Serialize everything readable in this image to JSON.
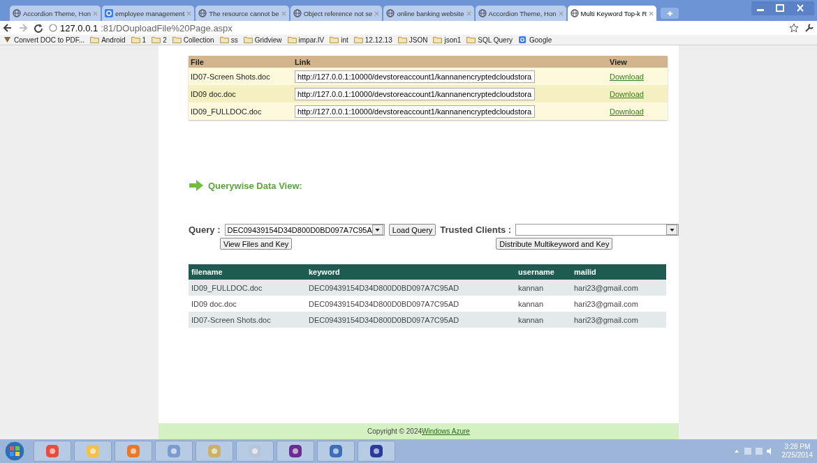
{
  "browser": {
    "tabs": [
      {
        "title": "Accordion Theme, Hon",
        "kind": "page",
        "selected": false
      },
      {
        "title": "employee management",
        "kind": "google",
        "selected": false
      },
      {
        "title": "The resource cannot be",
        "kind": "page",
        "selected": false
      },
      {
        "title": "Object reference not se",
        "kind": "page",
        "selected": false
      },
      {
        "title": "online banking website",
        "kind": "page",
        "selected": false
      },
      {
        "title": "Accordion Theme, Hon",
        "kind": "page",
        "selected": false
      },
      {
        "title": "Multi Keyword Top-k R",
        "kind": "page",
        "selected": true
      }
    ],
    "address": {
      "host": "127.0.0.1",
      "rest": ":81/DOuploadFile%20Page.aspx"
    },
    "bookmarks": [
      {
        "label": "Convert DOC to PDF...",
        "kind": "page"
      },
      {
        "label": "Android",
        "kind": "folder"
      },
      {
        "label": "1",
        "kind": "folder"
      },
      {
        "label": "2",
        "kind": "folder"
      },
      {
        "label": "Collection",
        "kind": "folder"
      },
      {
        "label": "ss",
        "kind": "folder"
      },
      {
        "label": "Gridview",
        "kind": "folder"
      },
      {
        "label": "impar.IV",
        "kind": "folder"
      },
      {
        "label": "int",
        "kind": "folder"
      },
      {
        "label": "12.12.13",
        "kind": "folder"
      },
      {
        "label": "JSON",
        "kind": "folder"
      },
      {
        "label": "json1",
        "kind": "folder"
      },
      {
        "label": "SQL Query",
        "kind": "folder"
      },
      {
        "label": "Google",
        "kind": "google"
      }
    ]
  },
  "files_table": {
    "columns": [
      "File",
      "Link",
      "View"
    ],
    "rows": [
      {
        "file": "ID07-Screen Shots.doc",
        "link": "http://127.0.0.1:10000/devstoreaccount1/kannanencryptedcloudstora",
        "action": "Download"
      },
      {
        "file": "ID09 doc.doc",
        "link": "http://127.0.0.1:10000/devstoreaccount1/kannanencryptedcloudstora",
        "action": "Download"
      },
      {
        "file": "ID09_FULLDOC.doc",
        "link": "http://127.0.0.1:10000/devstoreaccount1/kannanencryptedcloudstora",
        "action": "Download"
      }
    ]
  },
  "section_title": "Querywise Data View:",
  "query": {
    "label": "Query :",
    "value": "DEC09439154D34D800D0BD097A7C95A",
    "load_button": "Load Query",
    "view_button": "View Files and Key"
  },
  "trusted_clients": {
    "label": "Trusted Clients :",
    "distribute_button": "Distribute Multikeyword and Key"
  },
  "results_table": {
    "columns": [
      "filename",
      "keyword",
      "username",
      "mailid"
    ],
    "rows": [
      [
        "ID09_FULLDOC.doc",
        "DEC09439154D34D800D0BD097A7C95AD",
        "kannan",
        "hari23@gmail.com"
      ],
      [
        "ID09 doc.doc",
        "DEC09439154D34D800D0BD097A7C95AD",
        "kannan",
        "hari23@gmail.com"
      ],
      [
        "ID07-Screen Shots.doc",
        "DEC09439154D34D800D0BD097A7C95AD",
        "kannan",
        "hari23@gmail.com"
      ]
    ]
  },
  "footer": {
    "text": "Copyright © 2024",
    "link": "Windows Azure"
  },
  "taskbar": {
    "time": "3:28 PM",
    "date": "2/25/2014"
  }
}
